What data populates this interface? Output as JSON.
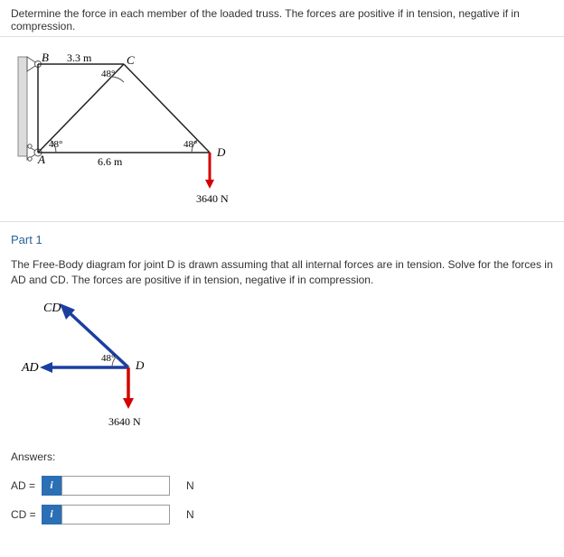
{
  "question": "Determine the force in each member of the loaded truss. The forces are positive if in tension, negative if in compression.",
  "truss": {
    "nodeA": "A",
    "nodeB": "B",
    "nodeC": "C",
    "nodeD": "D",
    "len_bc": "3.3 m",
    "len_ad": "6.6 m",
    "angle_c": "48°",
    "angle_a": "48°",
    "angle_d": "48°",
    "load": "3640 N"
  },
  "part1": {
    "title": "Part 1",
    "desc": "The Free-Body diagram for joint D is drawn assuming that all internal forces are in tension. Solve for the forces in AD and CD. The forces are positive if in tension, negative if in compression.",
    "fbd": {
      "cd": "CD",
      "ad": "AD",
      "angle": "48°",
      "node": "D",
      "load": "3640 N"
    },
    "answers_title": "Answers:",
    "row_ad": {
      "label": "AD =",
      "unit": "N"
    },
    "row_cd": {
      "label": "CD =",
      "unit": "N"
    },
    "info_glyph": "i"
  }
}
